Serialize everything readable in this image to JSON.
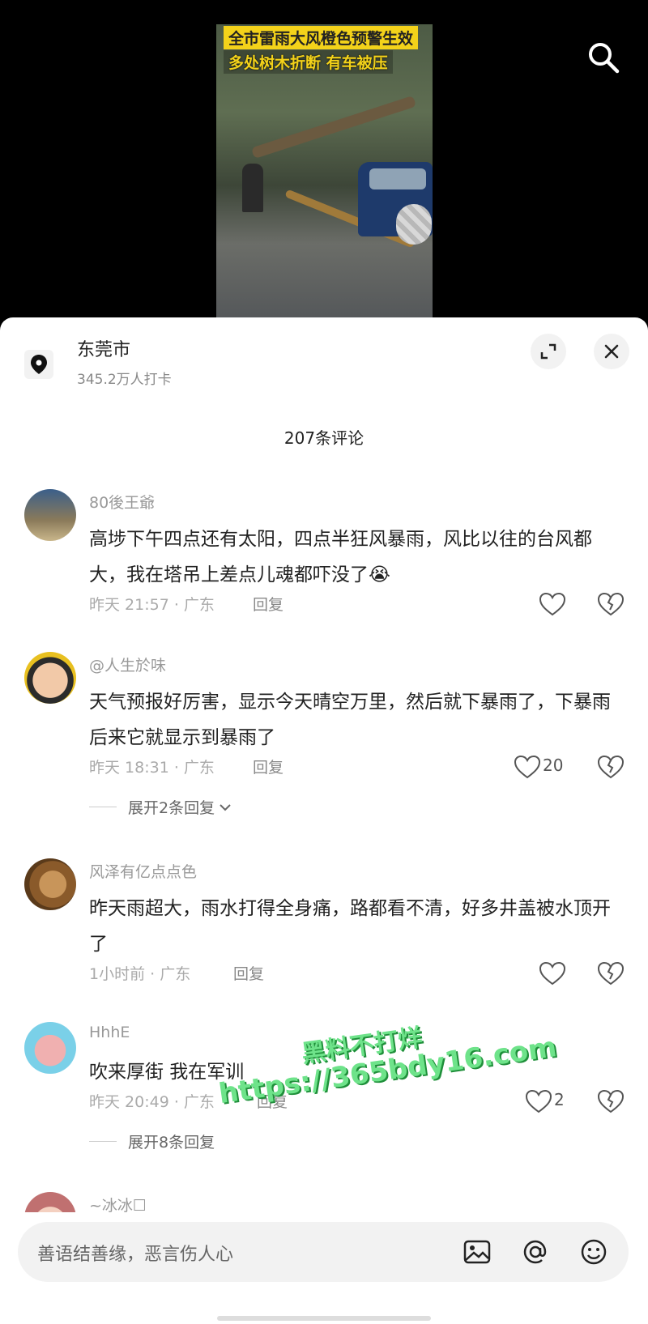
{
  "video": {
    "caption_line1": "全市雷雨大风橙色预警生效",
    "caption_line2": "多处树木折断 有车被压"
  },
  "location": {
    "name": "东莞市",
    "checkins": "345.2万人打卡"
  },
  "comments_title": "207条评论",
  "comments": [
    {
      "user": "80後王爺",
      "text": "高埗下午四点还有太阳，四点半狂风暴雨，风比以往的台风都大，我在塔吊上差点儿魂都吓没了😭",
      "meta": "昨天 21:57 · 广东",
      "reply": "回复",
      "likes": ""
    },
    {
      "user": "@人生於味",
      "text": "天气预报好厉害，显示今天晴空万里，然后就下暴雨了，下暴雨后来它就显示到暴雨了",
      "meta": "昨天 18:31 · 广东",
      "reply": "回复",
      "likes": "20",
      "expand": "展开2条回复"
    },
    {
      "user": "风泽有亿点点色",
      "text": "昨天雨超大，雨水打得全身痛，路都看不清，好多井盖被水顶开了",
      "meta": "1小时前 · 广东",
      "reply": "回复",
      "likes": ""
    },
    {
      "user": "HhhE",
      "text": "吹来厚街 我在军训",
      "meta": "昨天 20:49 · 广东",
      "reply": "回复",
      "likes": "2",
      "expand": "展开8条回复"
    },
    {
      "user": "~冰冰☐"
    }
  ],
  "watermark": {
    "line1": "黑料不打烊",
    "line2": "https://365bdy16.com"
  },
  "input": {
    "placeholder": "善语结善缘，恶言伤人心"
  }
}
